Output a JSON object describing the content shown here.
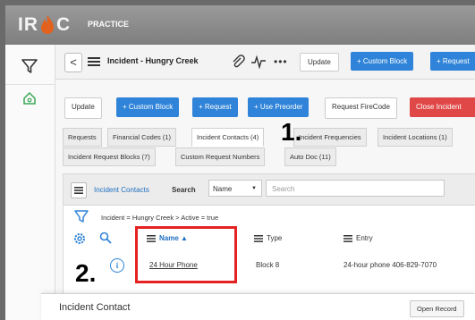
{
  "app": {
    "logo_left": "IR",
    "logo_right": "C",
    "name": "PRACTICE"
  },
  "header": {
    "back_glyph": "<",
    "record_title": "Incident - Hungry Creek",
    "more_glyph": "•••",
    "update_label": "Update",
    "custom_block_label": "+ Custom Block",
    "request_label": "+ Request"
  },
  "actions": {
    "update_label": "Update",
    "custom_block_label": "+ Custom Block",
    "request_label": "+ Request",
    "use_preorder_label": "+ Use Preorder",
    "request_firecode_label": "Request FireCode",
    "close_incident_label": "Close Incident"
  },
  "tabs_row1": [
    "Requests",
    "Financial Codes (1)",
    "Incident Contacts (4)",
    "Incident Frequencies",
    "Incident Locations (1)"
  ],
  "tabs_row2": [
    "Incident Request Blocks (7)",
    "Custom Request Numbers",
    "Auto Doc (11)"
  ],
  "subpanel": {
    "title": "Incident Contacts",
    "search_label": "Search",
    "search_field": "Name",
    "search_placeholder": "Search",
    "breadcrumb": "Incident = Hungry Creek  >  Active = true"
  },
  "table": {
    "columns": [
      "Name ▲",
      "Type",
      "Entry"
    ],
    "rows": [
      {
        "name": "24 Hour Phone",
        "type": "Block 8",
        "entry": "24-hour phone 406-829-7070"
      }
    ]
  },
  "annotations": {
    "step1": "1.",
    "step2": "2."
  },
  "bottom_panel": {
    "title": "Incident Contact",
    "open_record_label": "Open Record"
  },
  "colors": {
    "accent_blue": "#2f83d8",
    "danger_red": "#e04848",
    "highlight_box": "#e52222"
  }
}
